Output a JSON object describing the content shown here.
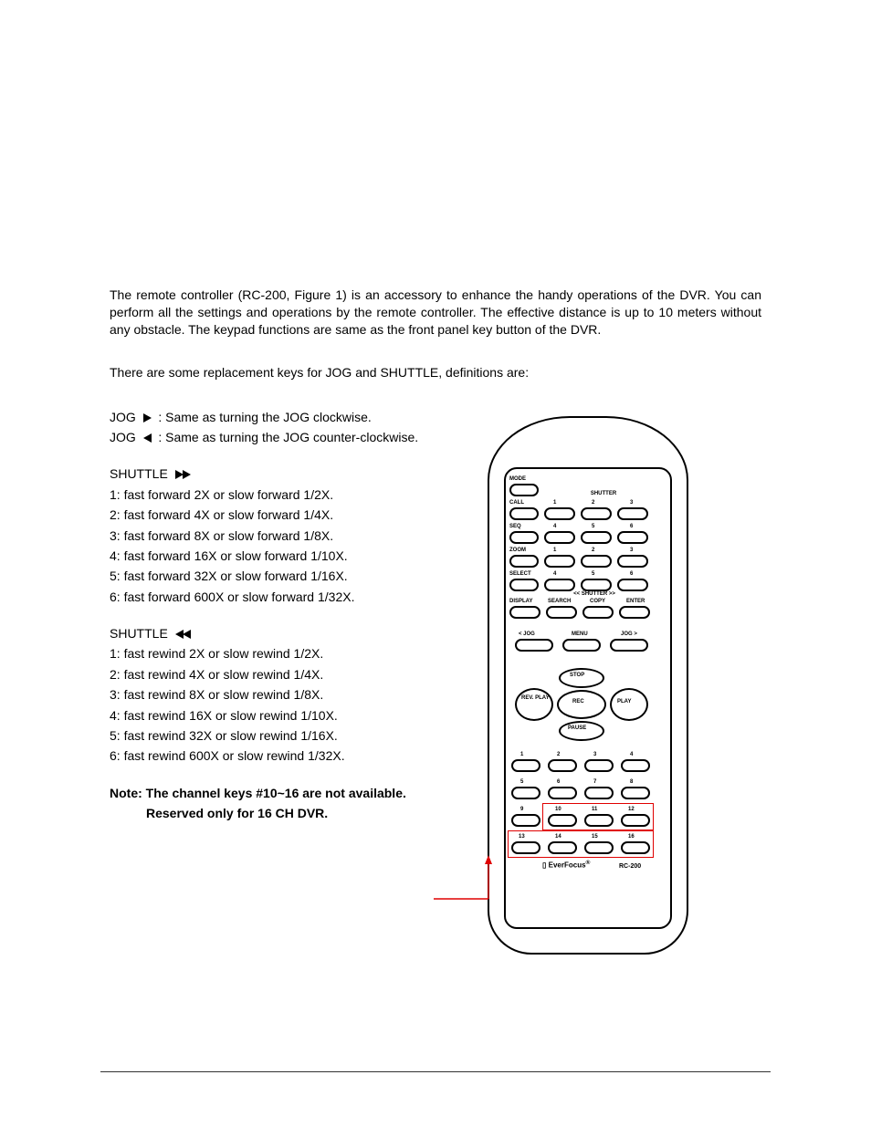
{
  "intro": "The remote controller (RC-200, Figure 1) is an accessory to enhance the handy operations of the DVR.  You can perform all the settings and operations by the remote controller.  The effective distance is up to 10 meters without any obstacle. The keypad functions are same as the front panel key button of the DVR.",
  "replace_line": "There are some replacement keys for JOG and SHUTTLE, definitions are:",
  "jog_label": "JOG",
  "jog_cw": ": Same as turning the JOG clockwise.",
  "jog_ccw": ": Same as turning the JOG counter-clockwise.",
  "shuttle_label": "SHUTTLE",
  "shuttle_ff": [
    "1: fast forward 2X or slow forward 1/2X.",
    "2: fast forward 4X or slow forward 1/4X.",
    "3: fast forward 8X or slow forward 1/8X.",
    "4: fast forward 16X or slow forward 1/10X.",
    "5: fast forward 32X or slow forward 1/16X.",
    "6: fast forward 600X or slow forward 1/32X."
  ],
  "shuttle_rr": [
    "1: fast rewind 2X or slow rewind 1/2X.",
    "2: fast rewind 4X or slow rewind 1/4X.",
    "3: fast rewind 8X or slow rewind 1/8X.",
    "4: fast rewind 16X or slow rewind 1/10X.",
    "5: fast rewind 32X or slow rewind 1/16X.",
    "6: fast rewind 600X or slow rewind 1/32X."
  ],
  "note1": "Note: The channel keys #10~16 are not available.",
  "note2": "Reserved only for 16 CH DVR.",
  "remote": {
    "labels": [
      "MODE",
      "CALL",
      "SEQ",
      "ZOOM",
      "SELECT",
      "DISPLAY",
      "SEARCH",
      "COPY",
      "ENTER",
      "SHUTTER",
      "< JOG",
      "MENU",
      "JOG >",
      "STOP",
      "REV. PLAY",
      "REC",
      "PLAY",
      "PAUSE",
      "<< SHUTTER >>"
    ],
    "nums_top_a": [
      "1",
      "2",
      "3"
    ],
    "nums_top_b": [
      "4",
      "5",
      "6"
    ],
    "nums_top_c": [
      "1",
      "2",
      "3"
    ],
    "nums_top_d": [
      "4",
      "5",
      "6"
    ],
    "brand": "EverFocus",
    "model": "RC-200",
    "channels_r1": [
      "1",
      "2",
      "3",
      "4"
    ],
    "channels_r2": [
      "5",
      "6",
      "7",
      "8"
    ],
    "channels_r3": [
      "9",
      "10",
      "11",
      "12"
    ],
    "channels_r4": [
      "13",
      "14",
      "15",
      "16"
    ]
  }
}
